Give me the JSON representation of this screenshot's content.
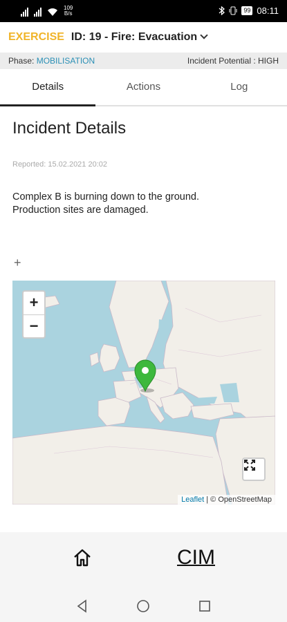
{
  "status_bar": {
    "net_speed": "109\nB/s",
    "time": "08:11",
    "battery": "99"
  },
  "header": {
    "mode_label": "EXERCISE",
    "incident_title": "ID: 19 - Fire: Evacuation"
  },
  "phase_bar": {
    "phase_label": "Phase:",
    "phase_value": "MOBILISATION",
    "potential_text": "Incident Potential : HIGH"
  },
  "tabs": [
    {
      "label": "Details",
      "active": true
    },
    {
      "label": "Actions",
      "active": false
    },
    {
      "label": "Log",
      "active": false
    }
  ],
  "details": {
    "heading": "Incident Details",
    "reported": "Reported: 15.02.2021 20:02",
    "description": "Complex B is burning down to the ground.\nProduction sites are damaged.",
    "add_symbol": "+"
  },
  "map": {
    "zoom_in": "+",
    "zoom_out": "−",
    "attribution_link": "Leaflet",
    "attribution_text": " | © OpenStreetMap",
    "marker_color": "#3db83d",
    "sea_color": "#aad3df",
    "land_color": "#f2efe9"
  },
  "bottom_nav": {
    "brand": "CIM"
  },
  "icons": {
    "home": "home-icon",
    "fullscreen": "fullscreen-icon",
    "marker": "map-marker-icon",
    "back": "back-icon",
    "home_sys": "circle-icon",
    "recents": "square-icon"
  }
}
